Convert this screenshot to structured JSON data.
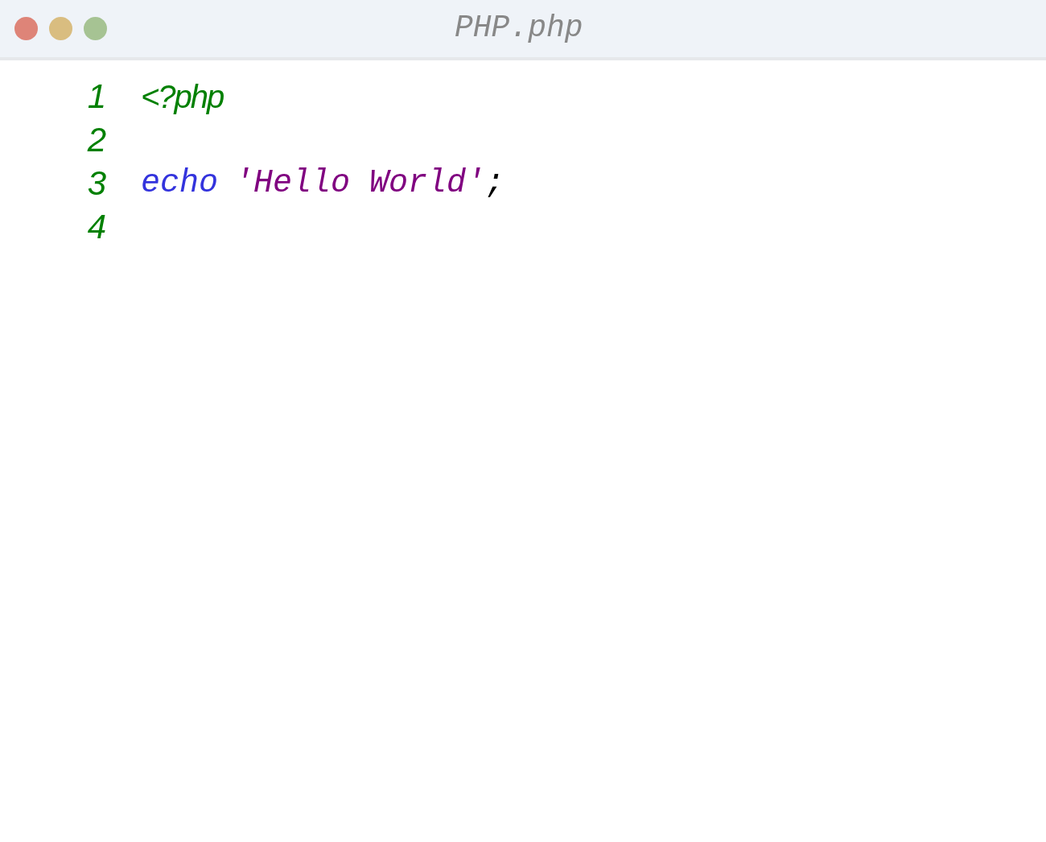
{
  "window": {
    "title": "PHP.php"
  },
  "lines": [
    {
      "number": "1",
      "tokens": [
        {
          "kind": "tag",
          "text": "<?php"
        }
      ]
    },
    {
      "number": "2"
    },
    {
      "number": "3",
      "tokens": [
        {
          "kind": "keyword",
          "text": "echo"
        },
        {
          "kind": "string",
          "text": "'Hello World'"
        },
        {
          "kind": "punct",
          "text": ";"
        }
      ]
    },
    {
      "number": "4"
    }
  ]
}
